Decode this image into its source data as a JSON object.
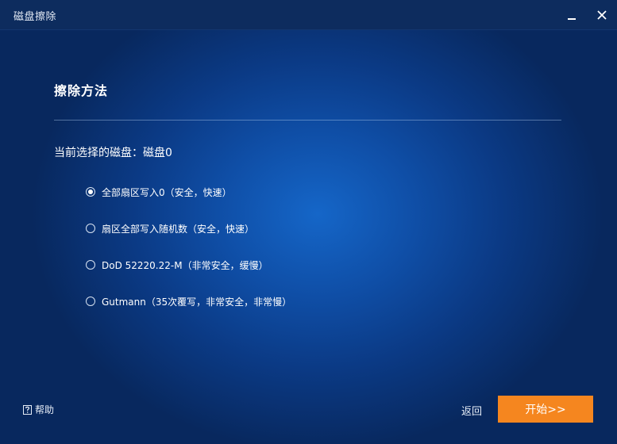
{
  "window": {
    "title": "磁盘擦除"
  },
  "main": {
    "section_title": "擦除方法",
    "current_disk_label": "当前选择的磁盘：磁盘0",
    "options": [
      {
        "label": "全部扇区写入0（安全，快速）",
        "selected": true
      },
      {
        "label": "扇区全部写入随机数（安全，快速）",
        "selected": false
      },
      {
        "label": "DoD 52220.22-M（非常安全，缓慢）",
        "selected": false
      },
      {
        "label": "Gutmann（35次覆写，非常安全，非常慢）",
        "selected": false
      }
    ]
  },
  "footer": {
    "help_label": "帮助",
    "back_label": "返回",
    "start_label": "开始>>"
  },
  "colors": {
    "accent_button": "#f5861f",
    "titlebar": "#0d2c5e",
    "background_center": "#1566c8",
    "background_edge": "#08285e"
  },
  "icons": {
    "minimize": "minimize-icon",
    "close": "close-icon",
    "help": "help-icon"
  }
}
